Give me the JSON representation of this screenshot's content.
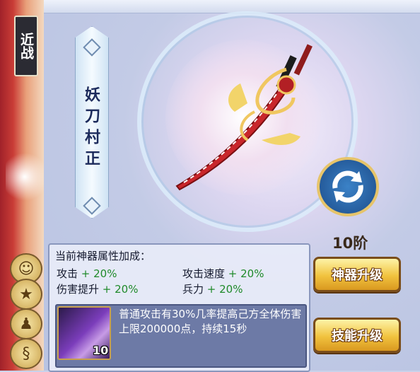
{
  "side_tab": {
    "label": "近战"
  },
  "weapon": {
    "name": "妖刀村正"
  },
  "stage_label": "10阶",
  "buttons": {
    "upgrade_weapon": "神器升级",
    "upgrade_skill": "技能升级"
  },
  "attributes": {
    "title": "当前神器属性加成：",
    "items": [
      {
        "name": "攻击",
        "bonus": "+ 20%"
      },
      {
        "name": "攻击速度",
        "bonus": "+ 20%"
      },
      {
        "name": "伤害提升",
        "bonus": "+ 20%"
      },
      {
        "name": "兵力",
        "bonus": "+ 20%"
      }
    ]
  },
  "skill": {
    "level": "10",
    "description": "普通攻击有30%几率提高己方全体伤害上限200000点，持续15秒"
  },
  "colors": {
    "accent": "#f1c23e",
    "bonus_green": "#1f8a2a",
    "panel_border": "#8a97bd"
  },
  "icons": {
    "refresh": "refresh-icon",
    "skill": "skill-icon"
  }
}
